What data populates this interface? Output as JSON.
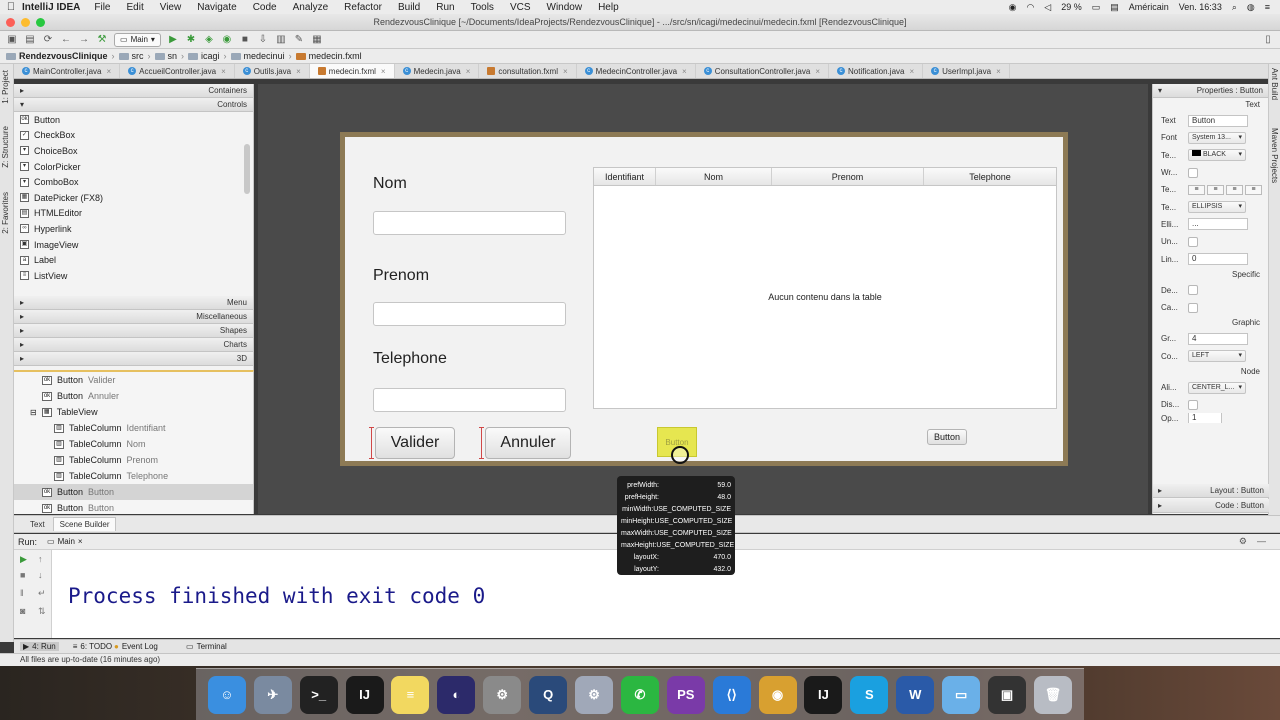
{
  "menubar": {
    "app_name": "IntelliJ IDEA",
    "items": [
      "File",
      "Edit",
      "View",
      "Navigate",
      "Code",
      "Analyze",
      "Refactor",
      "Build",
      "Run",
      "Tools",
      "VCS",
      "Window",
      "Help"
    ],
    "battery": "29 %",
    "input_source": "Américain",
    "clock": "Ven. 16:33"
  },
  "window": {
    "title": "RendezvousClinique [~/Documents/IdeaProjects/RendezvousClinique] - .../src/sn/icagi/medecinui/medecin.fxml [RendezvousClinique]"
  },
  "toolbar": {
    "run_config": "Main"
  },
  "breadcrumb": [
    "RendezvousClinique",
    "src",
    "sn",
    "icagi",
    "medecinui",
    "medecin.fxml"
  ],
  "editor_tabs": [
    {
      "label": "MainController.java",
      "kind": "c"
    },
    {
      "label": "AccueilController.java",
      "kind": "c"
    },
    {
      "label": "Outils.java",
      "kind": "c"
    },
    {
      "label": "medecin.fxml",
      "kind": "x",
      "active": true
    },
    {
      "label": "Medecin.java",
      "kind": "c"
    },
    {
      "label": "consultation.fxml",
      "kind": "x"
    },
    {
      "label": "MedecinController.java",
      "kind": "c"
    },
    {
      "label": "ConsultationController.java",
      "kind": "c"
    },
    {
      "label": "Notification.java",
      "kind": "c"
    },
    {
      "label": "UserImpl.java",
      "kind": "c"
    }
  ],
  "left_strip": {
    "project": "1: Project",
    "structure": "Z: Structure",
    "favorites": "2: Favorites"
  },
  "right_strip": {
    "ant": "Ant Build",
    "maven": "Maven Projects"
  },
  "library": {
    "containers": "Containers",
    "controls": "Controls",
    "items": [
      "Button",
      "CheckBox",
      "ChoiceBox",
      "ColorPicker",
      "ComboBox",
      "DatePicker  (FX8)",
      "HTMLEditor",
      "Hyperlink",
      "ImageView",
      "Label",
      "ListView"
    ],
    "sections": [
      "Menu",
      "Miscellaneous",
      "Shapes",
      "Charts",
      "3D"
    ]
  },
  "hierarchy": {
    "rows": [
      {
        "type": "Button",
        "name": "Valider"
      },
      {
        "type": "Button",
        "name": "Annuler"
      },
      {
        "type": "TableView",
        "name": ""
      },
      {
        "type": "TableColumn",
        "name": "Identifiant"
      },
      {
        "type": "TableColumn",
        "name": "Nom"
      },
      {
        "type": "TableColumn",
        "name": "Prenom"
      },
      {
        "type": "TableColumn",
        "name": "Telephone"
      },
      {
        "type": "Button",
        "name": "Button"
      },
      {
        "type": "Button",
        "name": "Button"
      }
    ]
  },
  "form": {
    "nom_label": "Nom",
    "prenom_label": "Prenom",
    "telephone_label": "Telephone",
    "valider": "Valider",
    "annuler": "Annuler",
    "selected_button": "Button",
    "button2": "Button"
  },
  "table": {
    "columns": [
      "Identifiant",
      "Nom",
      "Prenom",
      "Telephone"
    ],
    "empty": "Aucun contenu dans la table"
  },
  "tooltip": {
    "rows": [
      {
        "k": "prefWidth:",
        "v": "59.0"
      },
      {
        "k": "prefHeight:",
        "v": "48.0"
      },
      {
        "k": "minWidth:",
        "v": "USE_COMPUTED_SIZE"
      },
      {
        "k": "minHeight:",
        "v": "USE_COMPUTED_SIZE"
      },
      {
        "k": "maxWidth:",
        "v": "USE_COMPUTED_SIZE"
      },
      {
        "k": "maxHeight:",
        "v": "USE_COMPUTED_SIZE"
      },
      {
        "k": "layoutX:",
        "v": "470.0"
      },
      {
        "k": "layoutY:",
        "v": "432.0"
      }
    ]
  },
  "inspector": {
    "properties": "Properties",
    "properties_target": ": Button",
    "sec_text": "Text",
    "text_label": "Text",
    "text_value": "Button",
    "font_label": "Font",
    "font_value": "System 13...",
    "textfill_label": "Te...",
    "textfill_value": "BLACK",
    "wrap_label": "Wr...",
    "align_label": "Te...",
    "overrun_label": "Te...",
    "overrun_value": "ELLIPSIS",
    "ellipsis_label": "Elli...",
    "ellipsis_value": "...",
    "underline_label": "Un...",
    "linespacing_label": "Lin...",
    "linespacing_value": "0",
    "sec_specific": "Specific",
    "default_label": "De...",
    "cancel_label": "Ca...",
    "sec_graphic": "Graphic",
    "gap_label": "Gr...",
    "gap_value": "4",
    "content_label": "Co...",
    "content_value": "LEFT",
    "sec_node": "Node",
    "alignment_label": "Ali...",
    "alignment_value": "CENTER_L...",
    "disable_label": "Dis...",
    "opacity_label": "Op...",
    "opacity_value": "1",
    "layout_head": "Layout",
    "layout_target": ": Button",
    "code_head": "Code",
    "code_target": ": Button"
  },
  "mode_tabs": {
    "text": "Text",
    "scene_builder": "Scene Builder"
  },
  "run": {
    "label": "Run:",
    "config": "Main",
    "output": "Process finished with exit code 0"
  },
  "tool_windows": {
    "run": "4: Run",
    "todo": "6: TODO",
    "event_log": "Event Log",
    "terminal": "Terminal"
  },
  "status": "All files are up-to-date (16 minutes ago)",
  "dock": [
    {
      "name": "finder",
      "glyph": "☺",
      "color": "#3a8fe0"
    },
    {
      "name": "launchpad",
      "glyph": "✈",
      "color": "#7a8aa0"
    },
    {
      "name": "terminal",
      "glyph": ">_",
      "color": "#222222"
    },
    {
      "name": "intellij",
      "glyph": "IJ",
      "color": "#1a1a1a"
    },
    {
      "name": "notes",
      "glyph": "≡",
      "color": "#f2d860"
    },
    {
      "name": "eclipse",
      "glyph": "◐",
      "color": "#2c2a6a"
    },
    {
      "name": "system-preferences",
      "glyph": "⚙",
      "color": "#8a8a8a"
    },
    {
      "name": "quicktime",
      "glyph": "Q",
      "color": "#2a4a7a"
    },
    {
      "name": "settings",
      "glyph": "⚙",
      "color": "#a0a8b8"
    },
    {
      "name": "whatsapp",
      "glyph": "✆",
      "color": "#2bb741"
    },
    {
      "name": "phpstorm",
      "glyph": "PS",
      "color": "#7a3aa8"
    },
    {
      "name": "vscode",
      "glyph": "⟨⟩",
      "color": "#2a7ad8"
    },
    {
      "name": "chrome",
      "glyph": "◉",
      "color": "#d8a030"
    },
    {
      "name": "intellij-2",
      "glyph": "IJ",
      "color": "#1a1a1a"
    },
    {
      "name": "skype",
      "glyph": "S",
      "color": "#1aa0e0"
    },
    {
      "name": "word",
      "glyph": "W",
      "color": "#2a5aa8"
    },
    {
      "name": "folder",
      "glyph": "▭",
      "color": "#6ab0e8"
    },
    {
      "name": "screen",
      "glyph": "▣",
      "color": "#333333"
    },
    {
      "name": "trash",
      "glyph": "🗑",
      "color": "#b8bcc4"
    }
  ]
}
